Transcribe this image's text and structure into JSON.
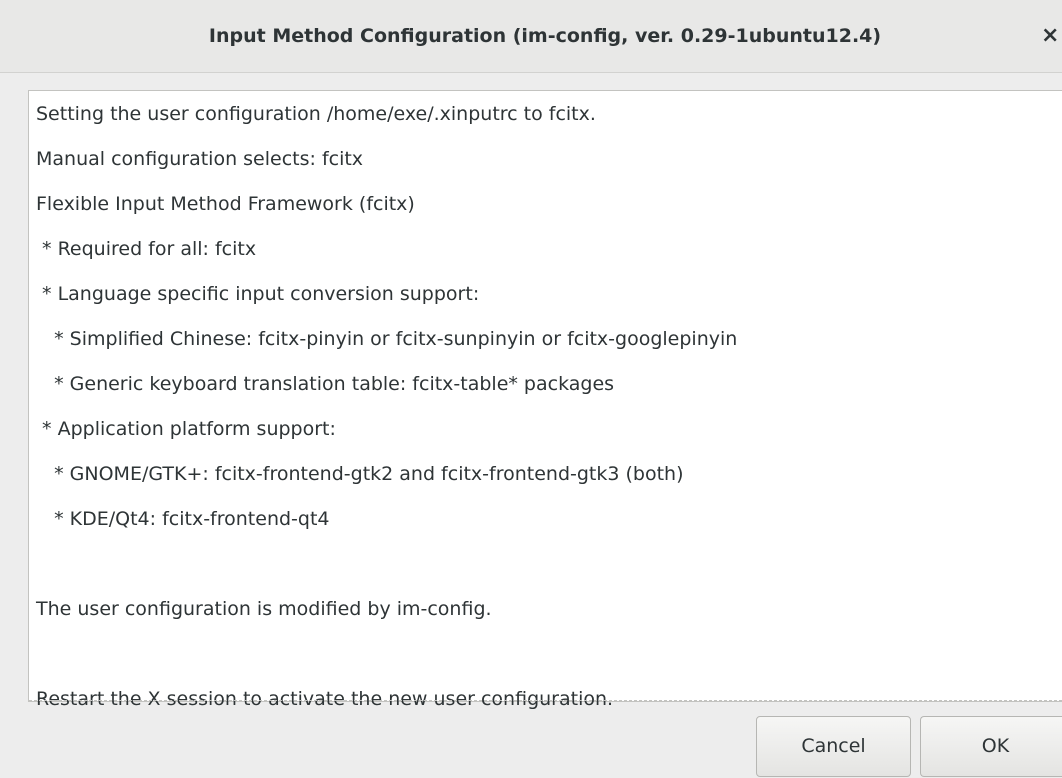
{
  "window": {
    "title": "Input Method Configuration (im-config, ver. 0.29-1ubuntu12.4)",
    "close_glyph": "×"
  },
  "message": {
    "lines": [
      "Setting the user configuration /home/exe/.xinputrc to fcitx.",
      "Manual configuration selects: fcitx",
      "Flexible Input Method Framework (fcitx)",
      " * Required for all: fcitx",
      " * Language specific input conversion support:",
      "   * Simplified Chinese: fcitx-pinyin or fcitx-sunpinyin or fcitx-googlepinyin",
      "   * Generic keyboard translation table: fcitx-table* packages",
      " * Application platform support:",
      "   * GNOME/GTK+: fcitx-frontend-gtk2 and fcitx-frontend-gtk3 (both)",
      "   * KDE/Qt4: fcitx-frontend-qt4",
      "",
      "The user configuration is modified by im-config.",
      "",
      "Restart the X session to activate the new user configuration."
    ]
  },
  "buttons": {
    "cancel_label": "Cancel",
    "ok_label": "OK"
  }
}
